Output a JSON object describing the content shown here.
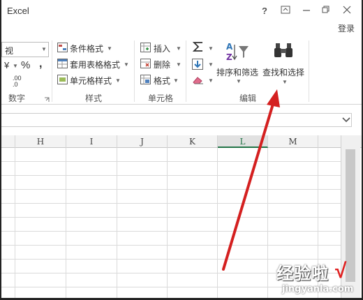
{
  "window": {
    "title": "Excel",
    "help": "?",
    "login": "登录"
  },
  "ribbon": {
    "number": {
      "format_value": "视",
      "currency": "¥",
      "percent": "%",
      "comma": ",",
      "dec_inc": ".00",
      "dec_dec": ".0",
      "group_label": "数字"
    },
    "styles": {
      "conditional": "条件格式",
      "table_format": "套用表格格式",
      "cell_styles": "单元格样式",
      "group_label": "样式"
    },
    "cells": {
      "insert": "插入",
      "delete": "删除",
      "format": "格式",
      "group_label": "单元格"
    },
    "editing": {
      "sort_filter": "排序和筛选",
      "find_select": "查找和选择",
      "group_label": "编辑"
    }
  },
  "grid": {
    "columns": [
      "H",
      "I",
      "J",
      "K",
      "L",
      "M"
    ],
    "active_column": "L"
  },
  "watermark": {
    "main": "经验啦",
    "url": "jingyanla.com",
    "check": "√"
  },
  "colors": {
    "accent_green": "#217346",
    "arrow_red": "#d42020"
  }
}
